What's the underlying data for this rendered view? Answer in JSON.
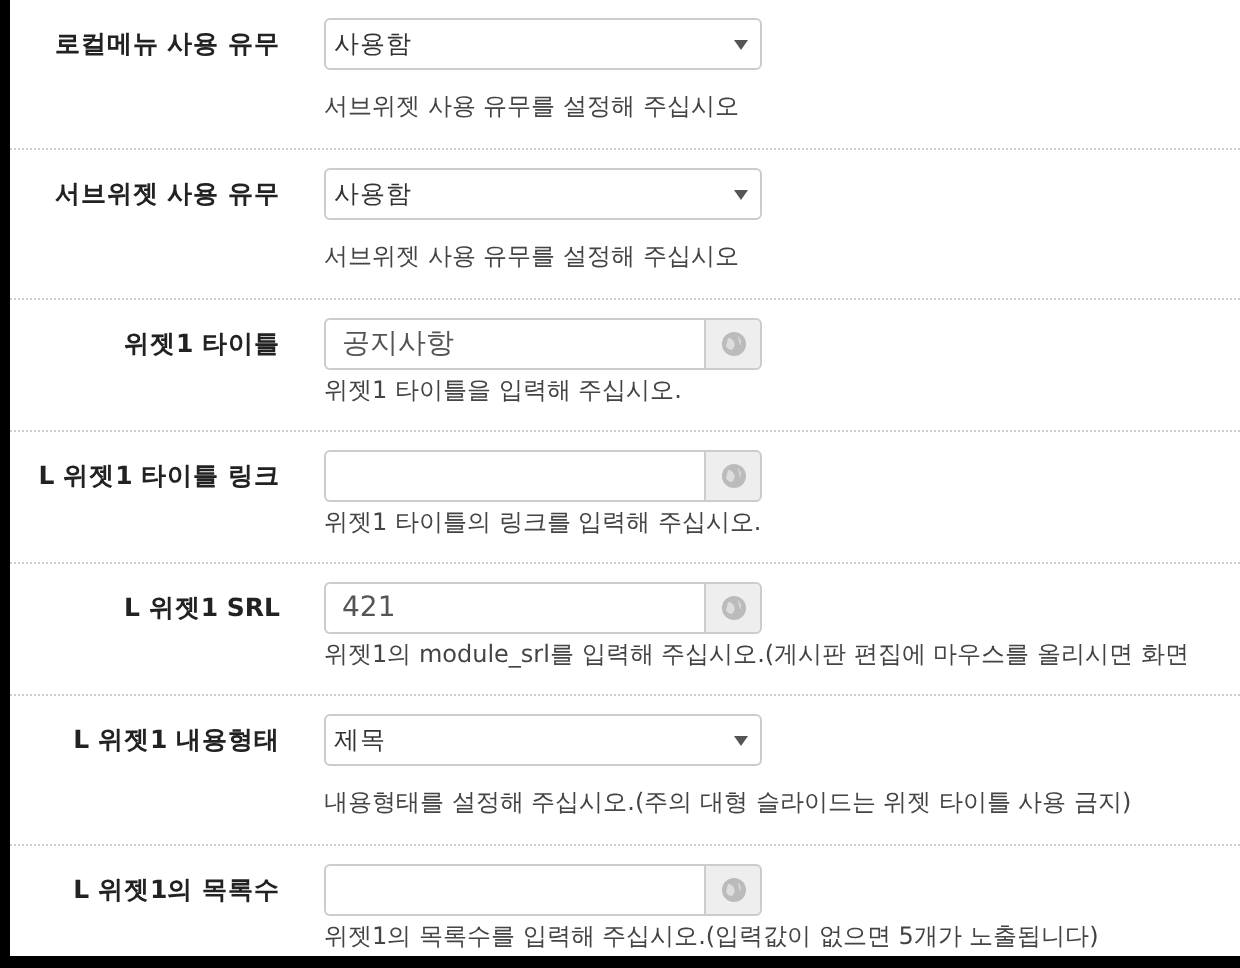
{
  "rows": [
    {
      "label": "로컬메뉴 사용 유무",
      "kind": "select",
      "value": "사용함",
      "help": "서브위젯 사용 유무를 설정해 주십시오"
    },
    {
      "label": "서브위젯 사용 유무",
      "kind": "select",
      "value": "사용함",
      "help": "서브위젯 사용 유무를 설정해 주십시오"
    },
    {
      "label": "위젯1 타이틀",
      "kind": "input",
      "value": "공지사항",
      "help": "위젯1 타이틀을 입력해 주십시오."
    },
    {
      "label": "L 위젯1 타이틀 링크",
      "kind": "input",
      "help": "위젯1 타이틀의 링크를 입력해 주십시오."
    },
    {
      "label": "L 위젯1 SRL",
      "kind": "input",
      "value": "421",
      "help": "위젯1의 module_srl를 입력해 주십시오.(게시판 편집에 마우스를 올리시면 화면"
    },
    {
      "label": "L 위젯1 내용형태",
      "kind": "select",
      "value": "제목",
      "help": "내용형태를 설정해 주십시오.(주의 대형 슬라이드는 위젯 타이틀 사용 금지)"
    },
    {
      "label": "L 위젯1의 목록수",
      "kind": "input",
      "help": "위젯1의 목록수를 입력해 주십시오.(입력값이 없으면 5개가 노출됩니다)"
    }
  ]
}
